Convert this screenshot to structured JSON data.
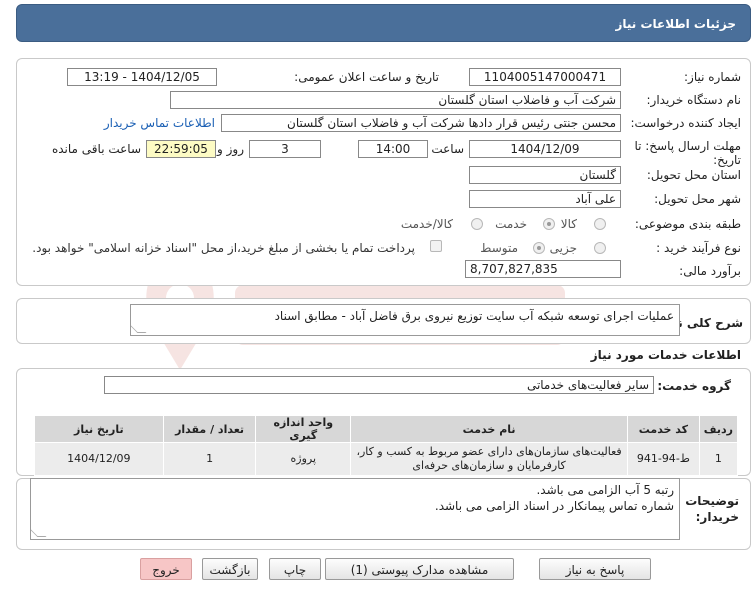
{
  "header": {
    "title": "جزئیات اطلاعات نیاز"
  },
  "form": {
    "need_number_label": "شماره نیاز:",
    "need_number": "1104005147000471",
    "announce_label": "تاریخ و ساعت اعلان عمومی:",
    "announce_value": "1404/12/05 - 13:19",
    "buyer_org_label": "نام دستگاه خریدار:",
    "buyer_org": "شرکت آب و فاضلاب استان گلستان",
    "creator_label": "ایجاد کننده درخواست:",
    "creator": "محسن جنتی رئیس قرار دادها شرکت آب و فاضلاب استان گلستان",
    "contact_link": "اطلاعات تماس خریدار",
    "deadline_label_1": "مهلت ارسال پاسخ: تا",
    "deadline_label_2": "تاریخ:",
    "deadline_date": "1404/12/09",
    "time_label": "ساعت",
    "deadline_time": "14:00",
    "days_value": "3",
    "days_label": "روز و",
    "remaining_time": "22:59:05",
    "remaining_label": "ساعت باقی مانده",
    "province_label": "استان محل تحویل:",
    "province": "گلستان",
    "city_label": "شهر محل تحویل:",
    "city": "علی آباد",
    "category_label": "طبقه بندی موضوعی:",
    "category_options": [
      "کالا",
      "خدمت",
      "کالا/خدمت"
    ],
    "purchase_type_label": "نوع فرآیند خرید :",
    "purchase_options": [
      "جزیی",
      "متوسط"
    ],
    "payment_note": "پرداخت تمام یا بخشی از مبلغ خرید،از محل \"اسناد خزانه اسلامی\" خواهد بود.",
    "estimate_label": "برآورد مالی:",
    "estimate": "8,707,827,835"
  },
  "summary": {
    "label": "شرح کلی نیاز:",
    "text": "عملیات اجرای توسعه شبکه آب سایت توزیع نیروی برق فاضل آباد - مطابق اسناد"
  },
  "services": {
    "section_title": "اطلاعات خدمات مورد نیاز",
    "group_label": "گروه خدمت:",
    "group_value": "سایر فعالیت‌های خدماتی"
  },
  "table": {
    "headers": [
      "ردیف",
      "کد خدمت",
      "نام خدمت",
      "واحد اندازه گیری",
      "تعداد / مقدار",
      "تاریخ نیاز"
    ],
    "rows": [
      [
        "1",
        "ط-94-941",
        "فعالیت‌های سازمان‌های دارای عضو مربوط به کسب و کار، کارفرمایان و سازمان‌های حرفه‌ای",
        "پروژه",
        "1",
        "1404/12/09"
      ]
    ]
  },
  "notes": {
    "label_1": "توضیحات",
    "label_2": "خریدار:",
    "line_1": "رتبه 5 آب الزامی می باشد.",
    "line_2": "شماره تماس پیمانکار در اسناد الزامی می باشد."
  },
  "buttons": {
    "reply": "پاسخ به نیاز",
    "docs": "مشاهده مدارک پیوستی (1)",
    "print": "چاپ",
    "back": "بازگشت",
    "exit": "خروج"
  },
  "colors": {
    "header_bg": "#4a6f9a",
    "yellow_field": "#fdfbc4",
    "link": "#1a5fb4",
    "exit_button": "#f7c6c6"
  }
}
